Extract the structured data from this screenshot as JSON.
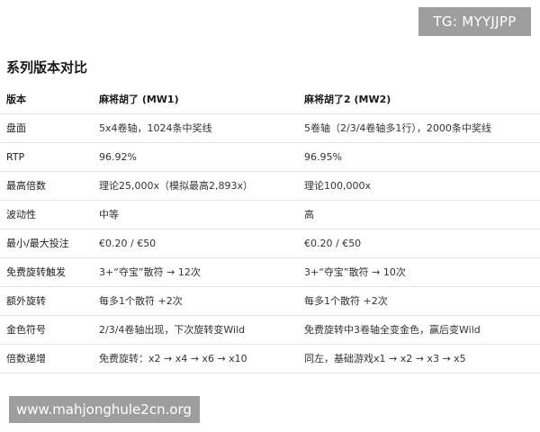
{
  "badge": {
    "text": "TG: MYYJJPP"
  },
  "section": {
    "title": "系列版本对比"
  },
  "table": {
    "headers": [
      "版本",
      "麻将胡了 (MW1)",
      "麻将胡了2 (MW2)"
    ],
    "rows": [
      [
        "盘面",
        "5x4卷轴，1024条中奖线",
        "5卷轴（2/3/4卷轴多1行），2000条中奖线"
      ],
      [
        "RTP",
        "96.92%",
        "96.95%"
      ],
      [
        "最高倍数",
        "理论25,000x（模拟最高2,893x）",
        "理论100,000x"
      ],
      [
        "波动性",
        "中等",
        "高"
      ],
      [
        "最小/最大投注",
        "€0.20 / €50",
        "€0.20 / €50"
      ],
      [
        "免费旋转触发",
        "3+“夺宝”散符 → 12次",
        "3+“夺宝”散符 → 10次"
      ],
      [
        "额外旋转",
        "每多1个散符 +2次",
        "每多1个散符 +2次"
      ],
      [
        "金色符号",
        "2/3/4卷轴出现，下次旋转变Wild",
        "免费旋转中3卷轴全变金色，赢后变Wild"
      ],
      [
        "倍数递增",
        "免费旋转：x2 → x4 → x6 → x10",
        "同左，基础游戏x1 → x2 → x3 → x5"
      ]
    ]
  },
  "watermark": {
    "text": "www.mahjonghule2cn.org"
  }
}
